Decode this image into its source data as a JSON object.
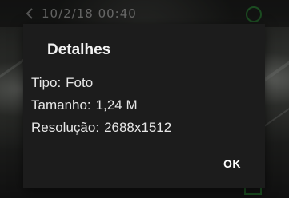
{
  "background": {
    "top_title": "10/2/18 00:40",
    "accent_color": "#2e8b3a"
  },
  "dialog": {
    "title": "Detalhes",
    "rows": [
      {
        "label": "Tipo:",
        "value": "Foto"
      },
      {
        "label": "Tamanho:",
        "value": "1,24 M"
      },
      {
        "label": "Resolução:",
        "value": "2688x1512"
      }
    ],
    "ok_label": "OK"
  }
}
